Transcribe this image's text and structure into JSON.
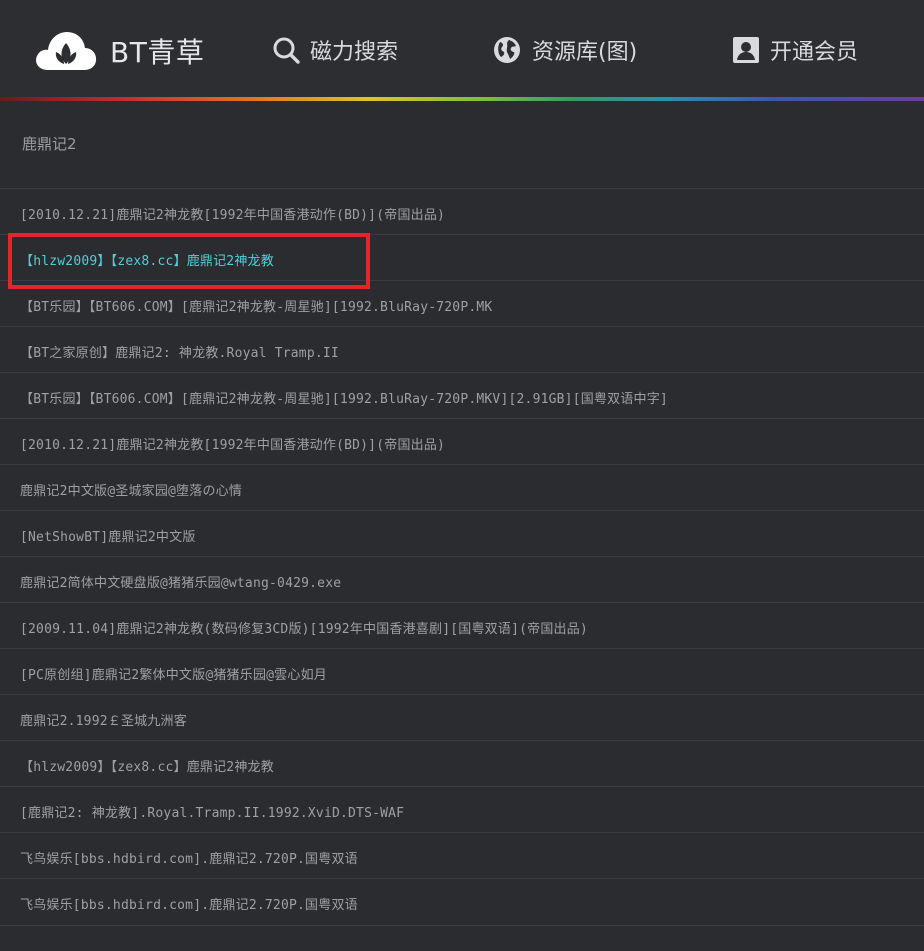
{
  "header": {
    "brand": "BT青草",
    "nav": [
      {
        "label": "磁力搜索",
        "icon": "search-icon"
      },
      {
        "label": "资源库(图)",
        "icon": "globe-icon"
      },
      {
        "label": "开通会员",
        "icon": "user-card-icon"
      }
    ],
    "logo_icon": "cloud-leaf-logo"
  },
  "query": {
    "text": "鹿鼎记2"
  },
  "colors": {
    "background": "#2b2c30",
    "highlight_text": "#4fd0d8",
    "highlight_box": "#e1262c"
  },
  "results": [
    {
      "title": "[2010.12.21]鹿鼎记2神龙教[1992年中国香港动作(BD)](帝国出品)"
    },
    {
      "title": "【hlzw2009】【zex8.cc】鹿鼎记2神龙教"
    },
    {
      "title": "【BT乐园】【BT606.COM】[鹿鼎记2神龙教-周星驰][1992.BluRay-720P.MK"
    },
    {
      "title": "【BT之家原创】鹿鼎记2: 神龙教.Royal Tramp.II"
    },
    {
      "title": "【BT乐园】【BT606.COM】[鹿鼎记2神龙教-周星驰][1992.BluRay-720P.MKV][2.91GB][国粤双语中字]"
    },
    {
      "title": "[2010.12.21]鹿鼎记2神龙教[1992年中国香港动作(BD)](帝国出品)"
    },
    {
      "title": "鹿鼎记2中文版@圣城家园@堕落の心情"
    },
    {
      "title": "[NetShowBT]鹿鼎记2中文版"
    },
    {
      "title": "鹿鼎记2简体中文硬盘版@猪猪乐园@wtang-0429.exe"
    },
    {
      "title": "[2009.11.04]鹿鼎记2神龙教(数码修复3CD版)[1992年中国香港喜剧][国粤双语](帝国出品)"
    },
    {
      "title": "[PC原创组]鹿鼎记2繁体中文版@猪猪乐园@雲心如月"
    },
    {
      "title": "鹿鼎记2.1992￡圣城九洲客"
    },
    {
      "title": "【hlzw2009】【zex8.cc】鹿鼎记2神龙教"
    },
    {
      "title": "[鹿鼎记2: 神龙教].Royal.Tramp.II.1992.XviD.DTS-WAF"
    },
    {
      "title": "飞鸟娱乐[bbs.hdbird.com].鹿鼎记2.720P.国粤双语"
    },
    {
      "title": "飞鸟娱乐[bbs.hdbird.com].鹿鼎记2.720P.国粤双语"
    }
  ]
}
